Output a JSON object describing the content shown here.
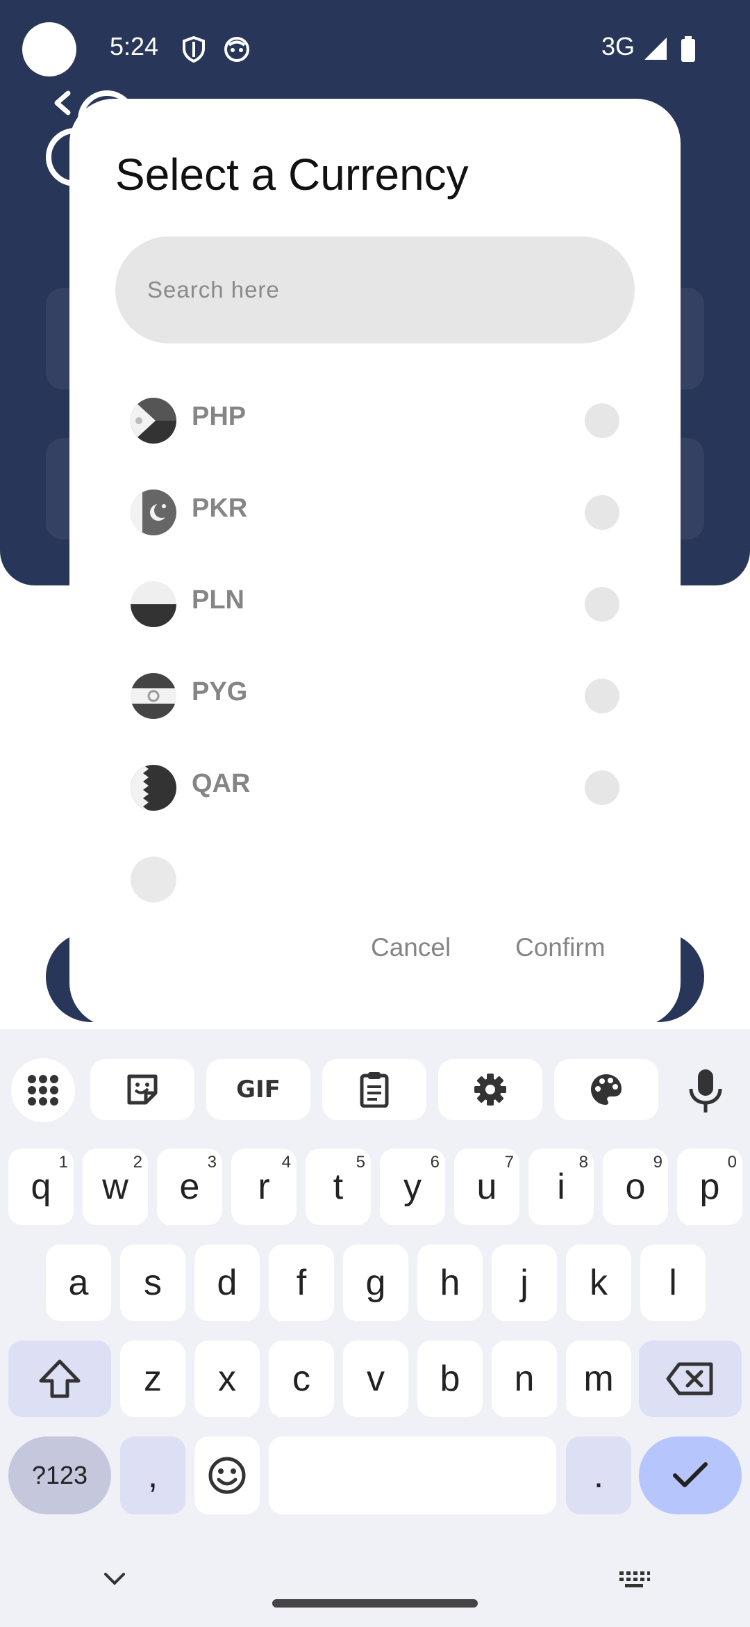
{
  "status_bar": {
    "time": "5:24",
    "network": "3G"
  },
  "dialog": {
    "title": "Select a Currency",
    "search_placeholder": "Search here",
    "currencies": [
      {
        "code": "PHP",
        "selected": false
      },
      {
        "code": "PKR",
        "selected": false
      },
      {
        "code": "PLN",
        "selected": false
      },
      {
        "code": "PYG",
        "selected": false
      },
      {
        "code": "QAR",
        "selected": false
      }
    ],
    "cancel_label": "Cancel",
    "confirm_label": "Confirm"
  },
  "keyboard": {
    "toolbar": [
      "apps-grid-icon",
      "sticker-icon",
      "GIF",
      "clipboard-icon",
      "settings-icon",
      "palette-icon",
      "mic-icon"
    ],
    "row1": [
      {
        "k": "q",
        "n": "1"
      },
      {
        "k": "w",
        "n": "2"
      },
      {
        "k": "e",
        "n": "3"
      },
      {
        "k": "r",
        "n": "4"
      },
      {
        "k": "t",
        "n": "5"
      },
      {
        "k": "y",
        "n": "6"
      },
      {
        "k": "u",
        "n": "7"
      },
      {
        "k": "i",
        "n": "8"
      },
      {
        "k": "o",
        "n": "9"
      },
      {
        "k": "p",
        "n": "0"
      }
    ],
    "row2": [
      "a",
      "s",
      "d",
      "f",
      "g",
      "h",
      "j",
      "k",
      "l"
    ],
    "row3": [
      "z",
      "x",
      "c",
      "v",
      "b",
      "n",
      "m"
    ],
    "symbols_label": "?123",
    "comma": ",",
    "period": "."
  },
  "colors": {
    "header_navy": "#283659",
    "keyboard_bg": "#f0f0f7",
    "enter_key": "#b6c5fb",
    "muted_text": "#858585"
  }
}
